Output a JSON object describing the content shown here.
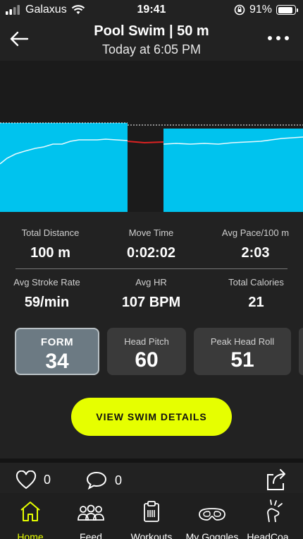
{
  "status_bar": {
    "carrier": "Galaxus",
    "time": "19:41",
    "battery": "91%",
    "battery_level": 0.91
  },
  "header": {
    "title": "Pool Swim | 50 m",
    "subtitle": "Today at 6:05 PM",
    "back_icon": "arrow-left-icon",
    "more_icon": "more-dots-icon"
  },
  "chart": {
    "colors": {
      "fill": "#00c3ee",
      "line": "#ffffff",
      "rest": "#dd2222",
      "dashed": "#ffffff"
    }
  },
  "stats": [
    {
      "label": "Total Distance",
      "value": "100 m"
    },
    {
      "label": "Move Time",
      "value": "0:02:02"
    },
    {
      "label": "Avg Pace/100 m",
      "value": "2:03"
    },
    {
      "label": "Avg Stroke Rate",
      "value": "59/min"
    },
    {
      "label": "Avg HR",
      "value": "107 BPM"
    },
    {
      "label": "Total Calories",
      "value": "21"
    }
  ],
  "cards": [
    {
      "label": "FORM",
      "value": "34"
    },
    {
      "label": "Head Pitch",
      "value": "60"
    },
    {
      "label": "Peak Head Roll",
      "value": "51"
    }
  ],
  "cta": {
    "label": "VIEW SWIM DETAILS",
    "color": "#e6ff00"
  },
  "social": {
    "likes": "0",
    "comments": "0"
  },
  "tabs": [
    {
      "label": "Home",
      "icon": "home-icon",
      "active": true
    },
    {
      "label": "Feed",
      "icon": "people-icon"
    },
    {
      "label": "Workouts",
      "icon": "clipboard-icon"
    },
    {
      "label": "My Goggles",
      "icon": "goggles-icon"
    },
    {
      "label": "HeadCoa…",
      "icon": "headcoach-icon"
    }
  ]
}
